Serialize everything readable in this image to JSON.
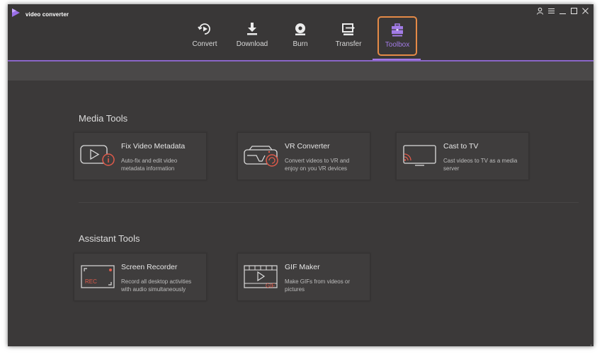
{
  "app": {
    "name": "video converter",
    "logo_icon": "play-logo-icon",
    "accent_color": "#a27be6",
    "highlight_color": "#e58a47"
  },
  "window_controls": [
    {
      "icon": "user-icon"
    },
    {
      "icon": "menu-icon"
    },
    {
      "icon": "minimize-icon"
    },
    {
      "icon": "maximize-icon"
    },
    {
      "icon": "close-icon"
    }
  ],
  "nav": {
    "items": [
      {
        "label": "Convert",
        "icon": "convert-icon",
        "active": false
      },
      {
        "label": "Download",
        "icon": "download-icon",
        "active": false
      },
      {
        "label": "Burn",
        "icon": "burn-icon",
        "active": false
      },
      {
        "label": "Transfer",
        "icon": "transfer-icon",
        "active": false
      },
      {
        "label": "Toolbox",
        "icon": "toolbox-icon",
        "active": true
      }
    ]
  },
  "media_tools": {
    "title": "Media Tools",
    "cards": [
      {
        "title": "Fix Video Metadata",
        "description": "Auto-fix and edit video metadata information",
        "icon": "video-info-icon"
      },
      {
        "title": "VR Converter",
        "description": "Convert videos to VR and enjoy on you VR devices",
        "icon": "vr-headset-icon"
      },
      {
        "title": "Cast to TV",
        "description": "Cast videos to TV as a media server",
        "icon": "cast-tv-icon"
      }
    ]
  },
  "assistant_tools": {
    "title": "Assistant Tools",
    "cards": [
      {
        "title": "Screen Recorder",
        "description": "Record all desktop activities with audio simultaneously",
        "icon": "screen-recorder-icon",
        "badge": "REC"
      },
      {
        "title": "GIF Maker",
        "description": "Make GIFs from videos or pictures",
        "icon": "gif-maker-icon",
        "badge": "GIF"
      }
    ]
  }
}
